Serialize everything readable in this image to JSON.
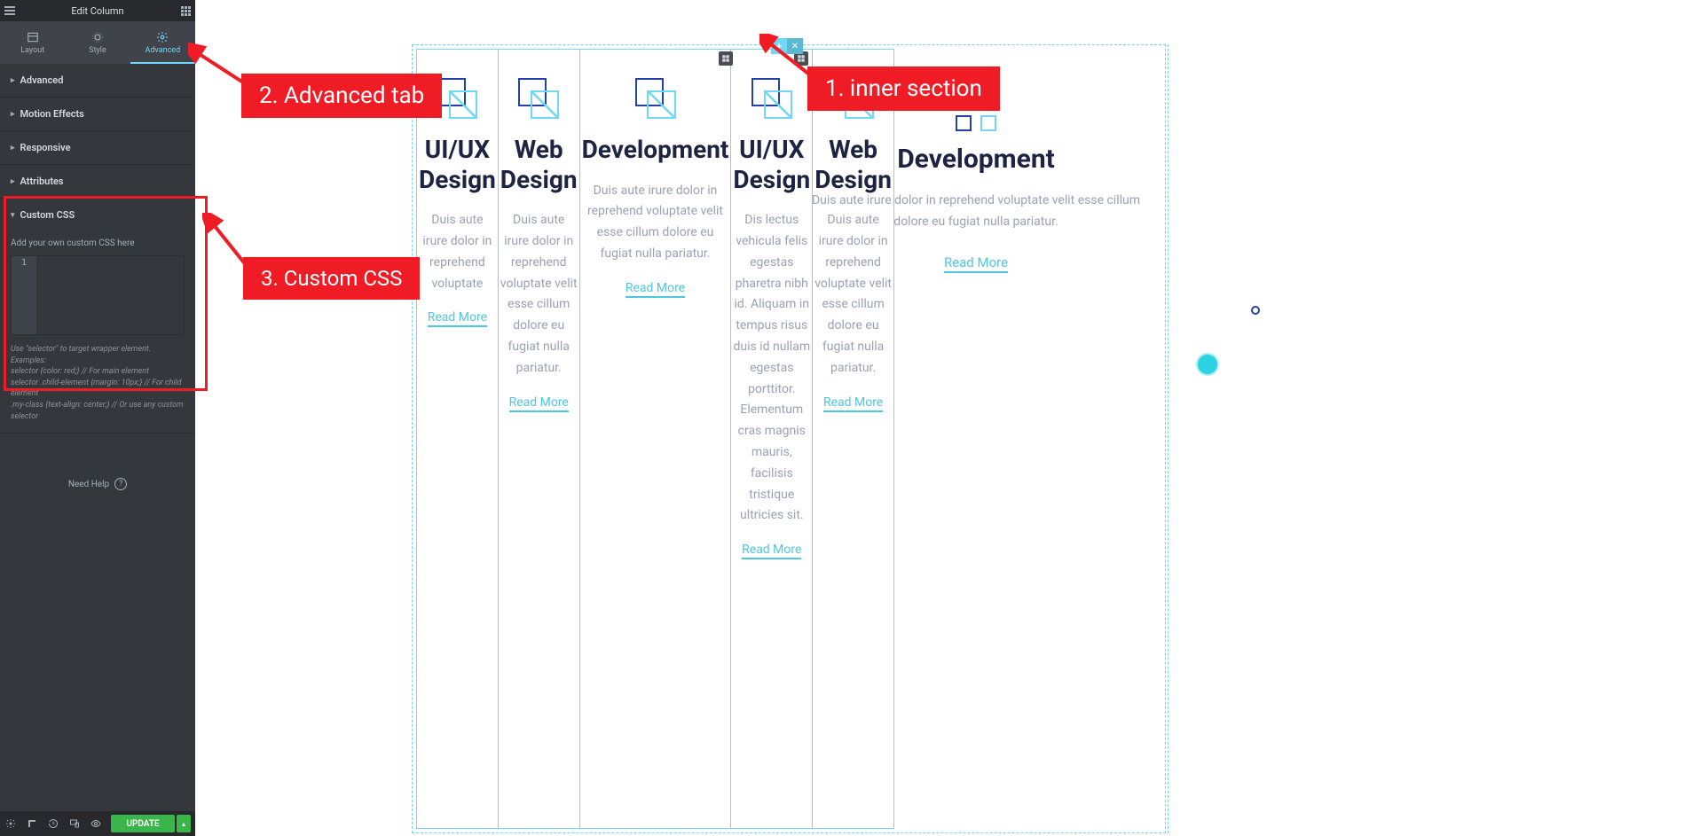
{
  "header": {
    "title": "Edit Column"
  },
  "tabs": {
    "layout": "Layout",
    "style": "Style",
    "advanced": "Advanced"
  },
  "accordion": {
    "advanced": "Advanced",
    "motion": "Motion Effects",
    "responsive": "Responsive",
    "attributes": "Attributes",
    "customcss": "Custom CSS"
  },
  "customcss": {
    "label": "Add your own custom CSS here",
    "linenum": "1",
    "help": "Use \"selector\" to target wrapper element. Examples:\nselector {color: red;} // For main element\nselector .child-element {margin: 10px;} // For child element\n.my-class {text-align: center;} // Or use any custom selector"
  },
  "needhelp": "Need Help",
  "footer": {
    "update": "UPDATE"
  },
  "cards": [
    {
      "title": "UI/UX Design",
      "text": "Duis aute irure dolor in reprehend voluptate",
      "link": "Read More"
    },
    {
      "title": "Web Design",
      "text": "Duis aute irure dolor in reprehend voluptate velit esse cillum dolore eu fugiat nulla pariatur.",
      "link": "Read More"
    },
    {
      "title": "Development",
      "text": "Duis aute irure dolor in reprehend voluptate velit esse cillum dolore eu fugiat nulla pariatur.",
      "link": "Read More"
    },
    {
      "title": "UI/UX Design",
      "text": "Dis lectus vehicula felis egestas pharetra nibh id. Aliquam in tempus risus duis id nullam egestas porttitor. Elementum cras magnis mauris, facilisis tristique ultricies sit.",
      "link": "Read More"
    },
    {
      "title": "Web Design",
      "text": "Duis aute irure dolor in reprehend voluptate velit esse cillum dolore eu fugiat nulla pariatur.",
      "link": "Read More"
    }
  ],
  "bigcard": {
    "title": "Development",
    "text": "Duis aute irure dolor in reprehend voluptate velit esse cillum dolore eu fugiat nulla pariatur.",
    "link": "Read More"
  },
  "annotations": {
    "one": "1. inner section",
    "two": "2. Advanced tab",
    "three": "3. Custom CSS"
  }
}
